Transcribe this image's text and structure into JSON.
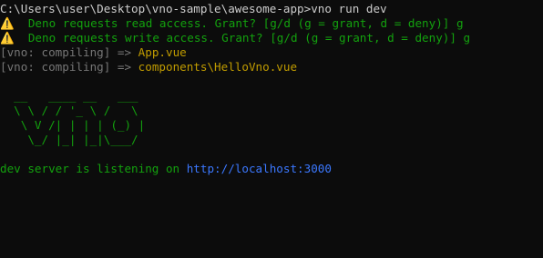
{
  "terminal": {
    "prompt": {
      "path": "C:\\Users\\user\\Desktop\\vno-sample\\awesome-app>",
      "command": "vno run dev"
    },
    "permissions": [
      {
        "glyph": "⚠️",
        "text": "  Deno requests read access. Grant? [g/d (g = grant, d = deny)] g"
      },
      {
        "glyph": "⚠️",
        "text": "  Deno requests write access. Grant? [g/d (g = grant, d = deny)] g"
      }
    ],
    "compiling": [
      {
        "prefix": "[vno: compiling] => ",
        "file": "App.vue"
      },
      {
        "prefix": "[vno: compiling] => ",
        "file": "components\\HelloVno.vue"
      }
    ],
    "banner": [
      "  __   ____ __   ___  ",
      "  \\ \\ / / '_ \\ /   \\",
      "   \\ V /| | | | (_) |",
      "    \\_/ |_| |_|\\___/ "
    ],
    "dev_server": {
      "text": "dev server is listening on ",
      "url": "http://localhost:3000"
    },
    "colors": {
      "background": "#0c0c0c",
      "green": "#13a10e",
      "gray": "#767676",
      "yellow": "#c19c00",
      "blue": "#3b78ff",
      "white": "#cccccc"
    }
  }
}
